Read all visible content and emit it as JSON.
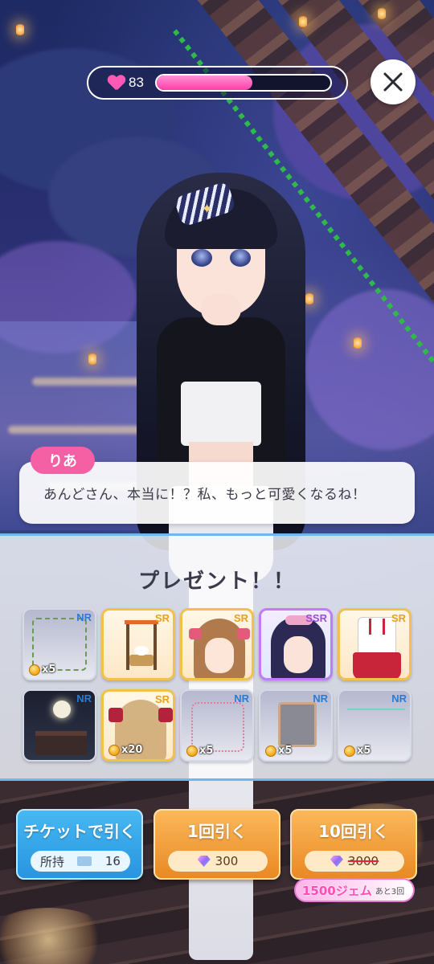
{
  "hud": {
    "affection": "83",
    "affection_progress": 0.55
  },
  "dialogue": {
    "speaker": "りあ",
    "text": "あんどさん、本当に！？私、もっと可愛くなるね！"
  },
  "present": {
    "title": "プレゼント！！",
    "items": [
      {
        "rarity": "NR",
        "qty": "x5",
        "art": "vine-frame"
      },
      {
        "rarity": "SR",
        "qty": "",
        "art": "altar"
      },
      {
        "rarity": "SR",
        "qty": "",
        "art": "brown-hair"
      },
      {
        "rarity": "SSR",
        "qty": "",
        "art": "dark-hair"
      },
      {
        "rarity": "SR",
        "qty": "",
        "art": "shrine-outfit"
      },
      {
        "rarity": "NR",
        "qty": "",
        "art": "moon-shrine"
      },
      {
        "rarity": "SR",
        "qty": "x20",
        "art": "blonde-hair"
      },
      {
        "rarity": "NR",
        "qty": "x5",
        "art": "heart-frame"
      },
      {
        "rarity": "NR",
        "qty": "x5",
        "art": "square-frame"
      },
      {
        "rarity": "NR",
        "qty": "x5",
        "art": "line-frame"
      }
    ]
  },
  "buttons": {
    "ticket": {
      "label": "チケットで引く",
      "owned_label": "所持",
      "owned_count": "16"
    },
    "single": {
      "label": "1回引く",
      "cost": "300"
    },
    "ten": {
      "label": "10回引く",
      "cost": "3000"
    }
  },
  "promo": {
    "main": "1500ジェム",
    "sub": "あと3回"
  },
  "colors": {
    "heart": "#ff58b5",
    "ticket_button": "#2994e0",
    "draw_button": "#e98924",
    "panel_border": "#6fb5f0"
  }
}
